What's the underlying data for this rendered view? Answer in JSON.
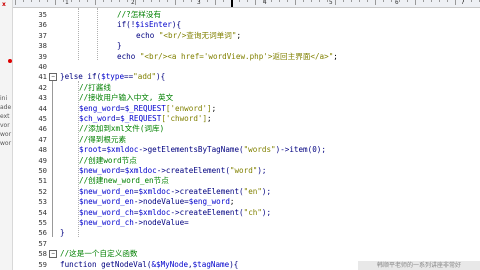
{
  "sidebar": {
    "close_label": "x",
    "items": [
      "ini",
      "ade",
      "ext",
      "vor",
      "wor",
      "wor"
    ]
  },
  "ruler": {
    "markers": [
      "1",
      "2",
      "3",
      "4",
      "5",
      "6",
      "7"
    ]
  },
  "editor": {
    "lines": [
      {
        "n": "35",
        "indent": 3,
        "parts": [
          {
            "t": "//?怎样没有",
            "c": "cmt"
          }
        ]
      },
      {
        "n": "36",
        "indent": 3,
        "parts": [
          {
            "t": "if(!",
            "c": "kw"
          },
          {
            "t": "$isEnter",
            "c": "var"
          },
          {
            "t": "){",
            "c": "kw"
          }
        ]
      },
      {
        "n": "37",
        "indent": 4,
        "parts": [
          {
            "t": "echo ",
            "c": "kw"
          },
          {
            "t": "\"<br/>查询无词单词\"",
            "c": "str"
          },
          {
            "t": ";",
            "c": "dark"
          }
        ]
      },
      {
        "n": "38",
        "indent": 3,
        "parts": [
          {
            "t": "}",
            "c": "kw"
          }
        ]
      },
      {
        "n": "39",
        "indent": 3,
        "parts": [
          {
            "t": "echo ",
            "c": "kw"
          },
          {
            "t": "\"<br/><a href='wordView.php'>返回主界面</a>\"",
            "c": "str"
          },
          {
            "t": ";",
            "c": "dark"
          }
        ]
      },
      {
        "n": "40",
        "indent": 0,
        "parts": [
          {
            "t": "",
            "c": "dark"
          }
        ]
      },
      {
        "n": "41",
        "indent": 0,
        "parts": [
          {
            "t": "}else if(",
            "c": "kw"
          },
          {
            "t": "$type",
            "c": "var"
          },
          {
            "t": "==",
            "c": "kw"
          },
          {
            "t": "\"add\"",
            "c": "str"
          },
          {
            "t": "){",
            "c": "kw"
          }
        ]
      },
      {
        "n": "42",
        "indent": 1,
        "parts": [
          {
            "t": "//打酱线",
            "c": "cmt"
          }
        ]
      },
      {
        "n": "43",
        "indent": 1,
        "parts": [
          {
            "t": "//接收用户输入中文, 英文",
            "c": "cmt"
          }
        ]
      },
      {
        "n": "44",
        "indent": 1,
        "parts": [
          {
            "t": "$eng_word",
            "c": "var"
          },
          {
            "t": "=",
            "c": "kw"
          },
          {
            "t": "$_REQUEST",
            "c": "var"
          },
          {
            "t": "['enword']",
            "c": "str"
          },
          {
            "t": ";",
            "c": "dark"
          }
        ]
      },
      {
        "n": "45",
        "indent": 1,
        "parts": [
          {
            "t": "$ch_word",
            "c": "var"
          },
          {
            "t": "=",
            "c": "kw"
          },
          {
            "t": "$_REQUEST",
            "c": "var"
          },
          {
            "t": "['chword']",
            "c": "str"
          },
          {
            "t": ";",
            "c": "dark"
          }
        ]
      },
      {
        "n": "46",
        "indent": 1,
        "parts": [
          {
            "t": "//添加到xml文件(词库)",
            "c": "cmt"
          }
        ]
      },
      {
        "n": "47",
        "indent": 1,
        "parts": [
          {
            "t": "//得到根元素",
            "c": "cmt"
          }
        ]
      },
      {
        "n": "48",
        "indent": 1,
        "parts": [
          {
            "t": "$root",
            "c": "var"
          },
          {
            "t": "=",
            "c": "kw"
          },
          {
            "t": "$xmldoc",
            "c": "var"
          },
          {
            "t": "->getElementsByTagName(",
            "c": "kw"
          },
          {
            "t": "\"words\"",
            "c": "str"
          },
          {
            "t": ")->item(0);",
            "c": "kw"
          }
        ]
      },
      {
        "n": "49",
        "indent": 1,
        "parts": [
          {
            "t": "//创建word节点",
            "c": "cmt"
          }
        ]
      },
      {
        "n": "50",
        "indent": 1,
        "parts": [
          {
            "t": "$new_word",
            "c": "var"
          },
          {
            "t": "=",
            "c": "kw"
          },
          {
            "t": "$xmldoc",
            "c": "var"
          },
          {
            "t": "->createElement(",
            "c": "kw"
          },
          {
            "t": "\"word\"",
            "c": "str"
          },
          {
            "t": ");",
            "c": "kw"
          }
        ]
      },
      {
        "n": "51",
        "indent": 1,
        "parts": [
          {
            "t": "//创建new_word_en节点",
            "c": "cmt"
          }
        ]
      },
      {
        "n": "52",
        "indent": 1,
        "parts": [
          {
            "t": "$new_word_en",
            "c": "var"
          },
          {
            "t": "=",
            "c": "kw"
          },
          {
            "t": "$xmldoc",
            "c": "var"
          },
          {
            "t": "->createElement(",
            "c": "kw"
          },
          {
            "t": "\"en\"",
            "c": "str"
          },
          {
            "t": ");",
            "c": "kw"
          }
        ]
      },
      {
        "n": "53",
        "indent": 1,
        "parts": [
          {
            "t": "$new_word_en",
            "c": "var"
          },
          {
            "t": "->nodeValue=",
            "c": "kw"
          },
          {
            "t": "$eng_word",
            "c": "var"
          },
          {
            "t": ";",
            "c": "dark"
          }
        ]
      },
      {
        "n": "54",
        "indent": 1,
        "parts": [
          {
            "t": "$new_word_ch",
            "c": "var"
          },
          {
            "t": "=",
            "c": "kw"
          },
          {
            "t": "$xmldoc",
            "c": "var"
          },
          {
            "t": "->createElement(",
            "c": "kw"
          },
          {
            "t": "\"ch\"",
            "c": "str"
          },
          {
            "t": ");",
            "c": "kw"
          }
        ]
      },
      {
        "n": "55",
        "indent": 1,
        "parts": [
          {
            "t": "$new_word_ch",
            "c": "var"
          },
          {
            "t": "->nodeValue=",
            "c": "kw"
          },
          {
            "t": "",
            "c": "dark"
          }
        ]
      },
      {
        "n": "56",
        "indent": 0,
        "parts": [
          {
            "t": "}",
            "c": "kw"
          }
        ]
      },
      {
        "n": "57",
        "indent": 0,
        "parts": [
          {
            "t": "",
            "c": "dark"
          }
        ]
      },
      {
        "n": "58",
        "indent": 0,
        "parts": [
          {
            "t": "//这是一个自定义函数",
            "c": "cmt"
          }
        ]
      },
      {
        "n": "59",
        "indent": 0,
        "parts": [
          {
            "t": "function ",
            "c": "kw"
          },
          {
            "t": "getNodeVal(",
            "c": "kw"
          },
          {
            "t": "&$MyNode",
            "c": "var"
          },
          {
            "t": ",",
            "c": "kw"
          },
          {
            "t": "$tagName",
            "c": "var"
          },
          {
            "t": "){",
            "c": "kw"
          }
        ]
      }
    ]
  },
  "watermark": "韩顺平老师的一系列讲座非常好"
}
